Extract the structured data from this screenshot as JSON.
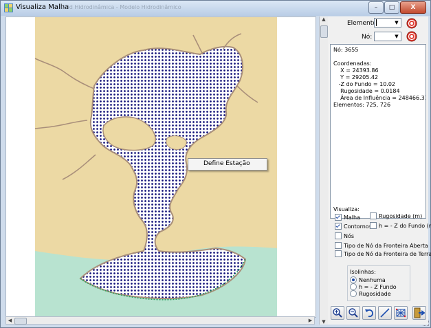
{
  "window": {
    "title": "Visualiza Malha",
    "title_ghost": "Grid Hidrodinâmica - Modelo Hidrodinâmico"
  },
  "caption": {
    "minimize": "–",
    "maximize": "□",
    "close": "X"
  },
  "selectors": {
    "elemento_label": "Elemento:",
    "no_label": "Nó:"
  },
  "info_text": "Nó: 3655\n\nCoordenadas:\n    X = 24393.86\n    Y = 29205.42\n   -Z do Fundo = 10.02\n    Rugosidade = 0.0184\n    Área de Influência = 248466.314\nElementos: 725, 726",
  "visualiza": {
    "title": "Visualiza:",
    "malha": "Malha",
    "contornos": "Contornos",
    "nos": "Nós",
    "rugosidade": "Rugosidade (m)",
    "h_fundo": "h = - Z do Fundo (m)",
    "tipo_aberta": "Tipo de Nó da Fronteira Aberta",
    "tipo_terra": "Tipo de Nó da Fronteira de Terra"
  },
  "isolinhas": {
    "title": "Isolinhas:",
    "nenhuma": "Nenhuma",
    "h_fundo": "h = - Z Fundo",
    "rugosidade": "Rugosidade"
  },
  "context_menu": {
    "define_estacao": "Define Estação"
  },
  "colors": {
    "land": "#ecd9a4",
    "sea": "#b8e3d0",
    "mesh": "#12127a",
    "shore": "#a98f7a"
  }
}
